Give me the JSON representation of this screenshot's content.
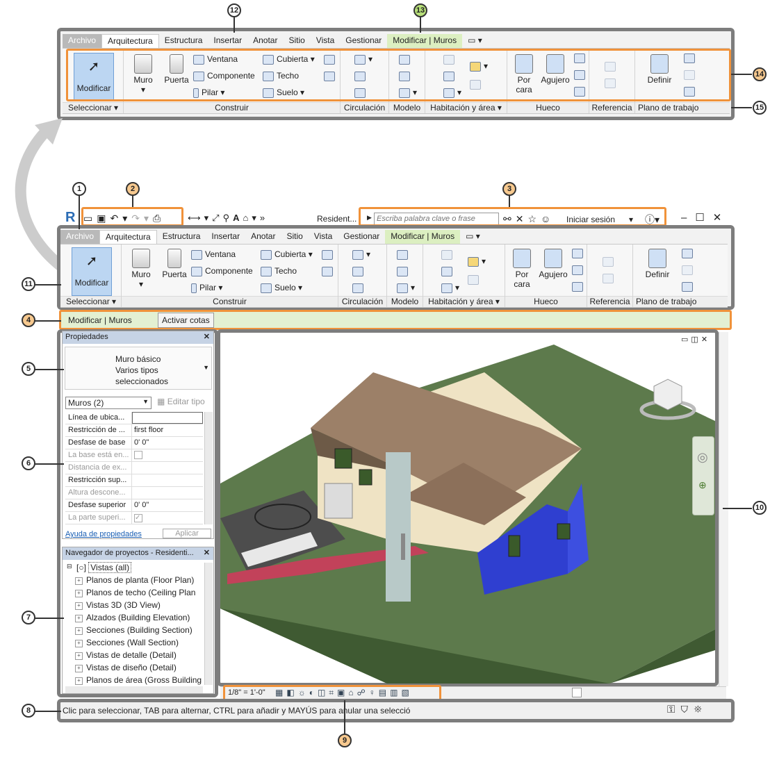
{
  "callouts": [
    "1",
    "2",
    "3",
    "4",
    "5",
    "6",
    "7",
    "8",
    "9",
    "10",
    "11",
    "12",
    "13",
    "14",
    "15"
  ],
  "top_ribbon": {
    "tabs": [
      "Archivo",
      "Arquitectura",
      "Estructura",
      "Insertar",
      "Anotar",
      "Sitio",
      "Vista",
      "Gestionar",
      "Modificar | Muros"
    ],
    "modify_label": "Modificar",
    "select_label": "Seleccionar",
    "build": {
      "muro": "Muro",
      "puerta": "Puerta",
      "ventana": "Ventana",
      "componente": "Componente",
      "pilar": "Pilar",
      "cubierta": "Cubierta",
      "techo": "Techo",
      "suelo": "Suelo"
    },
    "groups": [
      "Construir",
      "Circulación",
      "Modelo",
      "Habitación y área",
      "Hueco",
      "Referencia",
      "Plano de trabajo"
    ],
    "hueco": {
      "por_cara": "Por cara",
      "agujero": "Agujero"
    },
    "definir": "Definir"
  },
  "qat": {
    "doc_title": "Resident...",
    "search_placeholder": "Escriba palabra clave o frase",
    "signin": "Iniciar sesión"
  },
  "options_bar": {
    "context": "Modificar | Muros",
    "button": "Activar cotas"
  },
  "properties": {
    "title": "Propiedades",
    "type_line1": "Muro básico",
    "type_line2": "Varios tipos",
    "type_line3": "seleccionados",
    "filter": "Muros (2)",
    "edit_type": "Editar tipo",
    "rows": [
      {
        "k": "Línea de ubica...",
        "v": ""
      },
      {
        "k": "Restricción de ...",
        "v": "first floor"
      },
      {
        "k": "Desfase de base",
        "v": "0'  0\""
      },
      {
        "k": "La base está en...",
        "v": ""
      },
      {
        "k": "Distancia de ex...",
        "v": ""
      },
      {
        "k": "Restricción sup...",
        "v": ""
      },
      {
        "k": "Altura descone...",
        "v": ""
      },
      {
        "k": "Desfase superior",
        "v": "0'  0\""
      },
      {
        "k": "La parte superi...",
        "v": ""
      }
    ],
    "help": "Ayuda de propiedades",
    "apply": "Aplicar"
  },
  "browser": {
    "title": "Navegador de proyectos - Residenti...",
    "root": "Vistas (all)",
    "items": [
      "Planos de planta (Floor Plan)",
      "Planos de techo (Ceiling Plan",
      "Vistas 3D (3D View)",
      "Alzados (Building Elevation)",
      "Secciones (Building Section)",
      "Secciones (Wall Section)",
      "Vistas de detalle (Detail)",
      "Vistas de diseño (Detail)",
      "Planos de área (Gross Building"
    ]
  },
  "view_bar": {
    "scale": "1/8\" = 1'-0\""
  },
  "status_bar": {
    "text": "Clic para seleccionar, TAB para alternar, CTRL para añadir y MAYÚS para anular una selecció"
  },
  "colors": {
    "frame": "#7d7d7d",
    "highlight": "#f0923a",
    "contextual_tab": "#dcefc1",
    "selected_wall": "#2f3fd0",
    "ground": "#5d7a4c",
    "roof": "#9c8068"
  }
}
